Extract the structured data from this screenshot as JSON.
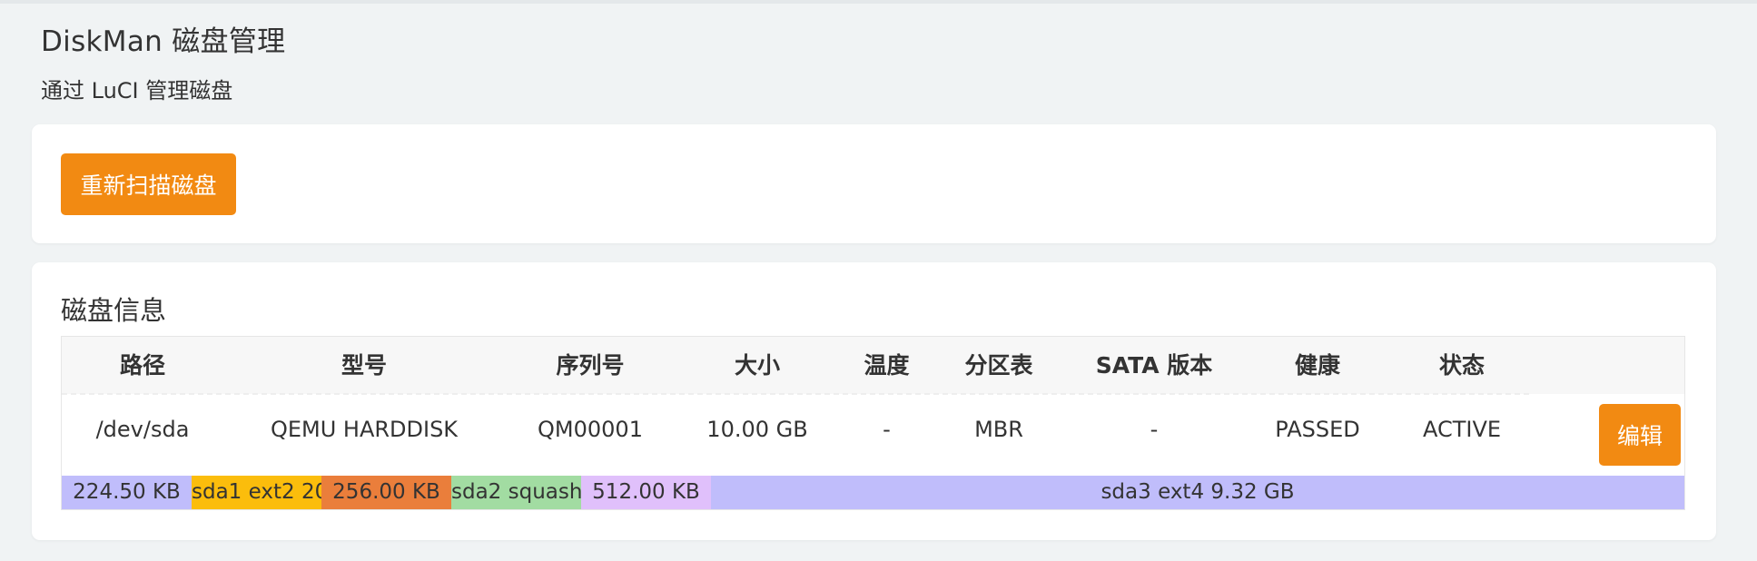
{
  "header": {
    "title": "DiskMan 磁盘管理",
    "description": "通过 LuCI 管理磁盘"
  },
  "actions": {
    "rescan_label": "重新扫描磁盘"
  },
  "disk_info": {
    "title": "磁盘信息",
    "columns": [
      "路径",
      "型号",
      "序列号",
      "大小",
      "温度",
      "分区表",
      "SATA 版本",
      "健康",
      "状态"
    ],
    "rows": [
      {
        "path": "/dev/sda",
        "model": "QEMU HARDDISK",
        "serial": "QM00001",
        "size": "10.00 GB",
        "temp": "-",
        "partition_table": "MBR",
        "sata_version": "-",
        "health": "PASSED",
        "status": "ACTIVE",
        "edit_label": "编辑"
      }
    ],
    "partitions": [
      {
        "label": "224.50 KB",
        "color": "#c0bdfb",
        "share": 0.08
      },
      {
        "label": "sda1 ext2 20",
        "color": "#fbbd0c",
        "share": 0.08
      },
      {
        "label": "256.00 KB",
        "color": "#ea7e3b",
        "share": 0.08
      },
      {
        "label": "sda2 squash",
        "color": "#a2dca2",
        "share": 0.08
      },
      {
        "label": "512.00 KB",
        "color": "#e0c0fb",
        "share": 0.08
      },
      {
        "label": "sda3 ext4 9.32 GB",
        "color": "#c0bdfb",
        "share": 0.6
      }
    ]
  },
  "colors": {
    "accent": "#f28a12",
    "background": "#f0f3f4",
    "card": "#ffffff"
  }
}
